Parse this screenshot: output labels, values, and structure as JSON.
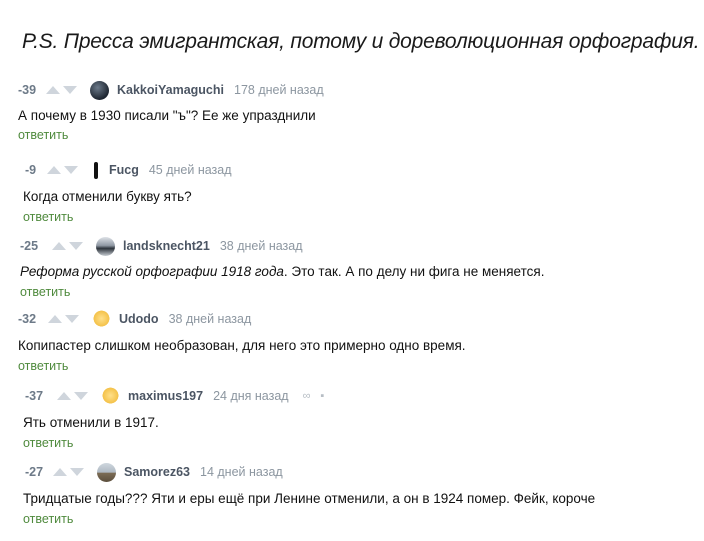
{
  "headline": "P.S. Пресса эмигрантская, потому и дореволюционная орфография.",
  "reply_label": "ответить",
  "colors": {
    "reply": "#4f8a3d",
    "rating": "#6d7a88",
    "arrow": "#cfd5dc"
  },
  "comments": [
    {
      "rating": "-39",
      "username": "KakkoiYamaguchi",
      "time": "178 дней назад",
      "avatar": "dark-circle-avatar",
      "text": "А почему в 1930 писали \"ъ\"? Ее же упразднили"
    },
    {
      "rating": "-9",
      "username": "Fucg",
      "time": "45 дней назад",
      "avatar": "figure-avatar",
      "text": "Когда отменили букву ять?"
    },
    {
      "rating": "-25",
      "username": "landsknecht21",
      "time": "38 дней назад",
      "avatar": "car-avatar",
      "text_italic": "Реформа русской орфографии 1918 года",
      "text": ". Это так. А по делу ни фига не меняется."
    },
    {
      "rating": "-32",
      "username": "Udodo",
      "time": "38 дней назад",
      "avatar": "emoji-avatar",
      "text": "Копипастер слишком необразован, для него это примерно одно время."
    },
    {
      "rating": "-37",
      "username": "maximus197",
      "time": "24 дня назад",
      "avatar": "emoji-avatar",
      "text": "Ять отменили в 1917."
    },
    {
      "rating": "-27",
      "username": "Samorez63",
      "time": "14 дней назад",
      "avatar": "landscape-avatar",
      "text": "Тридцатые годы??? Яти и еры ещё при Ленине отменили, а он в 1924 помер. Фейк, короче"
    }
  ]
}
